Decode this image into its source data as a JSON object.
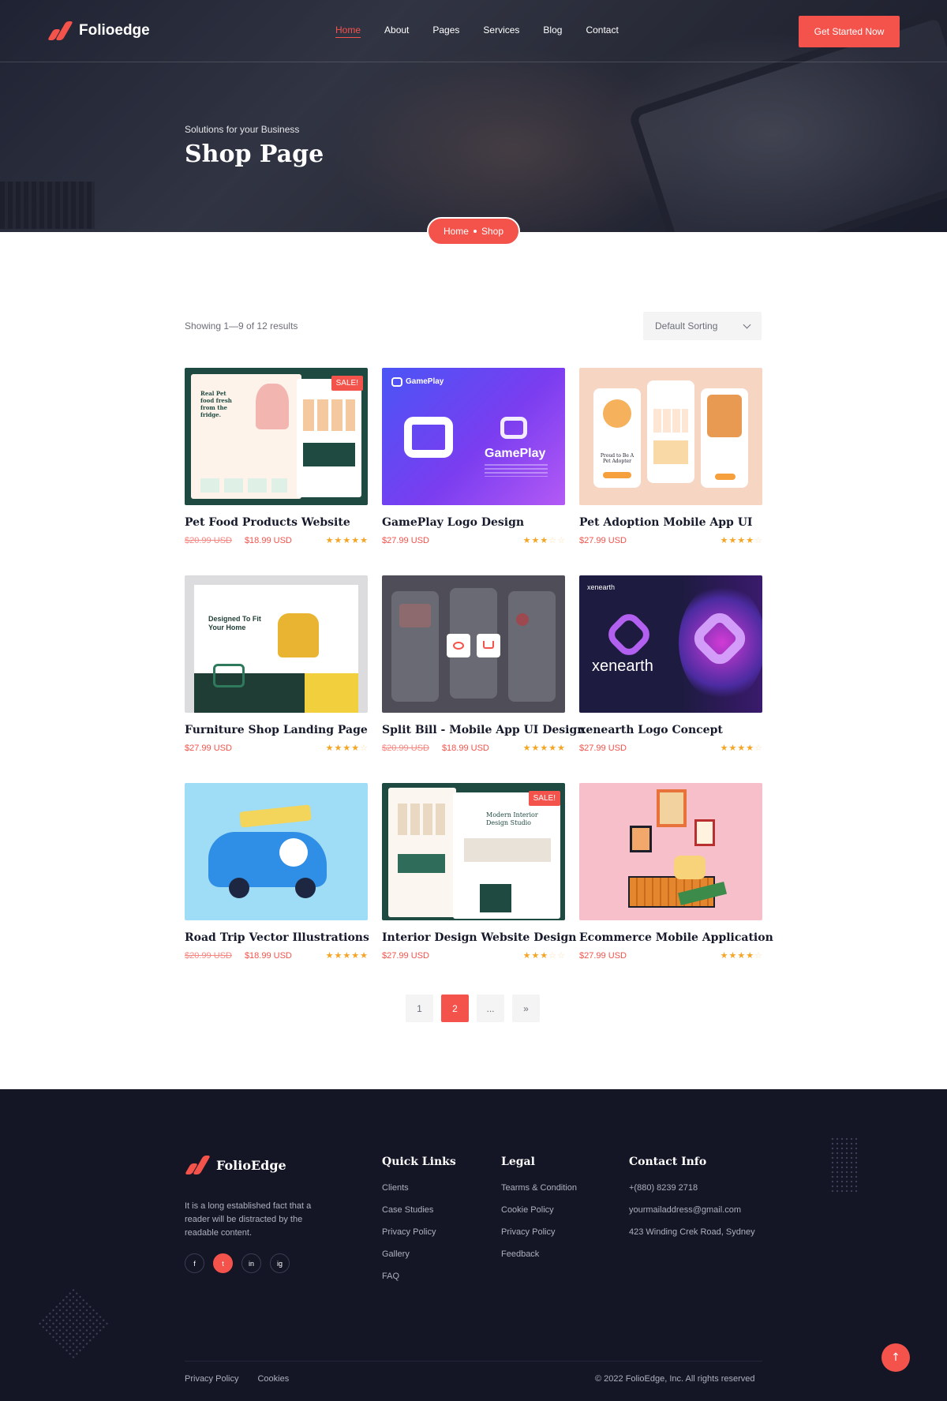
{
  "brand": {
    "name": "Folioedge",
    "footer_name": "FolioEdge"
  },
  "nav": {
    "items": [
      {
        "label": "Home",
        "active": true
      },
      {
        "label": "About"
      },
      {
        "label": "Pages"
      },
      {
        "label": "Services"
      },
      {
        "label": "Blog"
      },
      {
        "label": "Contact"
      }
    ],
    "cta": "Get Started Now"
  },
  "hero": {
    "subtitle": "Solutions for your Business",
    "title": "Shop Page",
    "breadcrumb": [
      "Home",
      "Shop"
    ]
  },
  "shop": {
    "showing": "Showing 1—9 of 12 results",
    "sorting": "Default Sorting",
    "products": [
      {
        "title": "Pet Food Products Website",
        "old_price": "$20.99 USD",
        "price": "$18.99 USD",
        "rating": 5,
        "sale": "SALE!",
        "thumb_text": "Real Pet food fresh from the fridge."
      },
      {
        "title": "GamePlay Logo Design",
        "old_price": "",
        "price": "$27.99 USD",
        "rating": 3,
        "sale": "",
        "thumb_text": "GamePlay"
      },
      {
        "title": "Pet Adoption Mobile App UI",
        "old_price": "",
        "price": "$27.99 USD",
        "rating": 4,
        "sale": "",
        "thumb_text": "Proud to Be A Pet Adopter"
      },
      {
        "title": "Furniture Shop Landing Page",
        "old_price": "",
        "price": "$27.99 USD",
        "rating": 4,
        "sale": "",
        "thumb_text": "Designed To Fit Your Home"
      },
      {
        "title": "Split Bill - Mobile App UI Design",
        "old_price": "$20.99 USD",
        "price": "$18.99 USD",
        "rating": 5,
        "sale": "",
        "thumb_text": ""
      },
      {
        "title": "xenearth Logo Concept",
        "old_price": "",
        "price": "$27.99 USD",
        "rating": 4,
        "sale": "",
        "thumb_text": "xenearth"
      },
      {
        "title": "Road Trip Vector Illustrations",
        "old_price": "$20.99 USD",
        "price": "$18.99 USD",
        "rating": 5,
        "sale": "",
        "thumb_text": ""
      },
      {
        "title": "Interior Design Website Design",
        "old_price": "",
        "price": "$27.99 USD",
        "rating": 3,
        "sale": "SALE!",
        "thumb_text": "Modern Interior Design Studio"
      },
      {
        "title": "Ecommerce Mobile Application",
        "old_price": "",
        "price": "$27.99 USD",
        "rating": 4,
        "sale": "",
        "thumb_text": ""
      }
    ],
    "pagination": [
      "1",
      "2",
      "...",
      "»"
    ],
    "current_page": "2"
  },
  "footer": {
    "description": "It is a long established fact that a reader will be distracted by the readable content.",
    "socials": [
      "f",
      "t",
      "in",
      "ig"
    ],
    "quick_links": {
      "title": "Quick Links",
      "items": [
        "Clients",
        "Case Studies",
        "Privacy Policy",
        "Gallery",
        "FAQ"
      ]
    },
    "legal": {
      "title": "Legal",
      "items": [
        "Tearms & Condition",
        "Cookie Policy",
        "Privacy Policy",
        "Feedback"
      ]
    },
    "contact": {
      "title": "Contact Info",
      "items": [
        "+(880) 8239 2718",
        "yourmailaddress@gmail.com",
        "423 Winding Crek Road, Sydney"
      ]
    },
    "bottom_links": [
      "Privacy Policy",
      "Cookies"
    ],
    "copyright": "© 2022 FolioEdge, Inc. All rights reserved"
  },
  "colors": {
    "accent": "#f4534b",
    "dark": "#141626",
    "star": "#f5a524"
  },
  "icons": {
    "sort": "chevron-down-icon",
    "scroll_top": "arrow-up-icon"
  }
}
